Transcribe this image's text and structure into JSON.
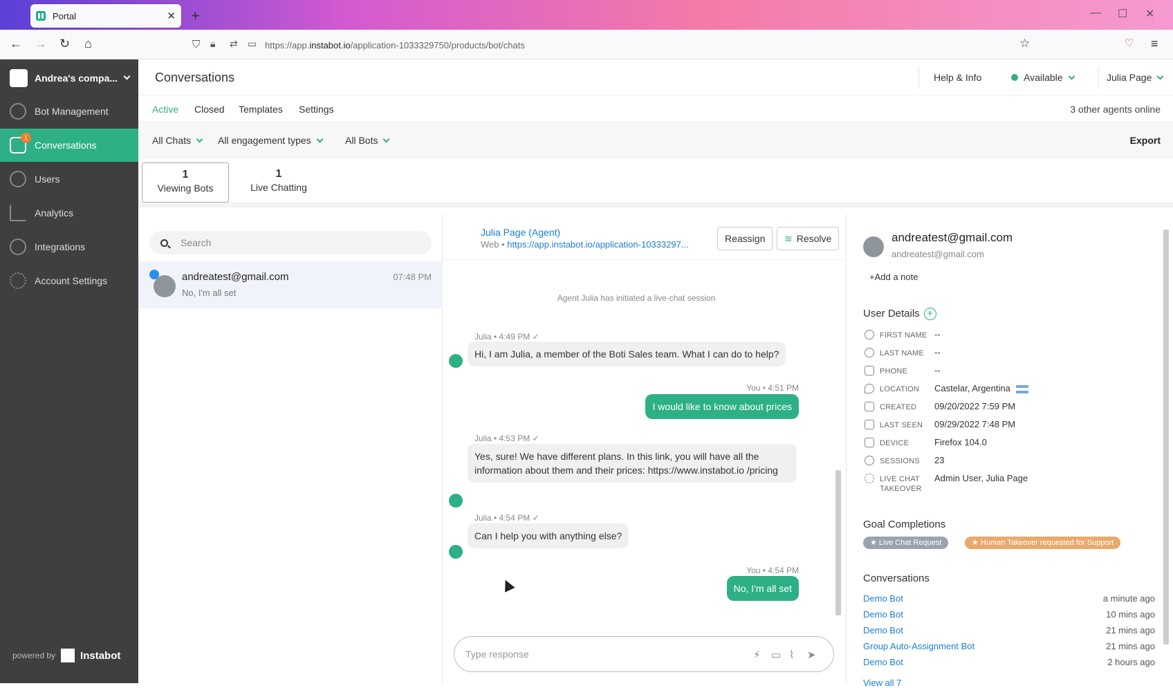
{
  "browser": {
    "tab_title": "Portal",
    "tab_close": "✕",
    "new_tab": "+",
    "url_prefix": "https://app.",
    "url_domain": "instabot.io",
    "url_path": "/application-1033329750/products/bot/chats"
  },
  "sidebar": {
    "company": "Andrea's compa...",
    "items": [
      {
        "label": "Bot Management",
        "icon": "robot-icon"
      },
      {
        "label": "Conversations",
        "icon": "chat-icon",
        "badge": "1",
        "active": true
      },
      {
        "label": "Users",
        "icon": "user-icon"
      },
      {
        "label": "Analytics",
        "icon": "chart-icon"
      },
      {
        "label": "Integrations",
        "icon": "puzzle-icon"
      },
      {
        "label": "Account Settings",
        "icon": "gear-icon"
      }
    ],
    "powered_by": "powered by",
    "brand": "Instabot"
  },
  "header": {
    "title": "Conversations",
    "help": "Help & Info",
    "status": "Available",
    "user": "Julia Page"
  },
  "subtabs": {
    "items": [
      "Active",
      "Closed",
      "Templates",
      "Settings"
    ],
    "active": "Active",
    "agents_online": "3 other agents online"
  },
  "filters": {
    "chats": "All Chats",
    "engagement": "All engagement types",
    "bots": "All Bots",
    "export": "Export"
  },
  "counts": {
    "viewing_bots": {
      "num": "1",
      "label": "Viewing Bots"
    },
    "live_chatting": {
      "num": "1",
      "label": "Live Chatting"
    }
  },
  "list": {
    "search_placeholder": "Search",
    "chats": [
      {
        "name": "andreatest@gmail.com",
        "time": "07:48 PM",
        "preview": "No, I'm all set"
      }
    ]
  },
  "chat": {
    "agent": "Julia Page (Agent)",
    "source_prefix": "Web • ",
    "source_link": "https://app.instabot.io/application-10333297...",
    "reassign": "Reassign",
    "resolve": "Resolve",
    "system_msg": "Agent Julia has initiated a live-chat session",
    "messages": [
      {
        "meta": "Julia • 4:49 PM ✓",
        "text": "Hi, I am Julia, a member of the Boti Sales team. What I can do to help?",
        "from": "agent"
      },
      {
        "meta": "You • 4:51 PM",
        "text": "I would like to know about prices",
        "from": "user"
      },
      {
        "meta": "Julia • 4:53 PM ✓",
        "text": "Yes, sure! We have different plans. In this link, you will have all the information about them and their prices: https://www.instabot.io /pricing",
        "from": "agent"
      },
      {
        "meta": "Julia • 4:54 PM ✓",
        "text": "Can I help you with anything else?",
        "from": "agent"
      },
      {
        "meta": "You • 4:54 PM",
        "text": "No, I'm all set",
        "from": "user"
      }
    ],
    "composer_placeholder": "Type response"
  },
  "details": {
    "email": "andreatest@gmail.com",
    "email_sub": "andreatest@gmail.com",
    "add_note": "+Add a note",
    "user_details_title": "User Details",
    "fields": [
      {
        "key": "FIRST NAME",
        "value": "--",
        "icon": "user-icon"
      },
      {
        "key": "LAST NAME",
        "value": "--",
        "icon": "user-icon"
      },
      {
        "key": "PHONE",
        "value": "--",
        "icon": "phone-icon"
      },
      {
        "key": "LOCATION",
        "value": "Castelar, Argentina",
        "icon": "pin-icon"
      },
      {
        "key": "CREATED",
        "value": "09/20/2022 7:59 PM",
        "icon": "calendar-icon"
      },
      {
        "key": "LAST SEEN",
        "value": "09/29/2022 7:48 PM",
        "icon": "calendar-icon"
      },
      {
        "key": "DEVICE",
        "value": "Firefox 104.0",
        "icon": "monitor-icon"
      },
      {
        "key": "SESSIONS",
        "value": "23",
        "icon": "eye-icon"
      },
      {
        "key": "LIVE CHAT",
        "key2": "TAKEOVER",
        "value": "Admin User, Julia Page",
        "icon": "takeover-icon"
      }
    ],
    "goals_title": "Goal Completions",
    "goals": [
      {
        "label": "★ Live Chat Request",
        "color": "#9aa3ad"
      },
      {
        "label": "★ Human Takeover requested for Support",
        "color": "#e9a96b"
      }
    ],
    "conversations_title": "Conversations",
    "conversations": [
      {
        "name": "Demo Bot",
        "time": "a minute ago"
      },
      {
        "name": "Demo Bot",
        "time": "10 mins ago"
      },
      {
        "name": "Demo Bot",
        "time": "21 mins ago"
      },
      {
        "name": "Group Auto-Assignment Bot",
        "time": "21 mins ago"
      },
      {
        "name": "Demo Bot",
        "time": "2 hours ago"
      }
    ],
    "view_all": "View all 7"
  },
  "colors": {
    "accent": "#2eb086",
    "link": "#1a7fd0",
    "sidebar": "#3f3f3f"
  }
}
